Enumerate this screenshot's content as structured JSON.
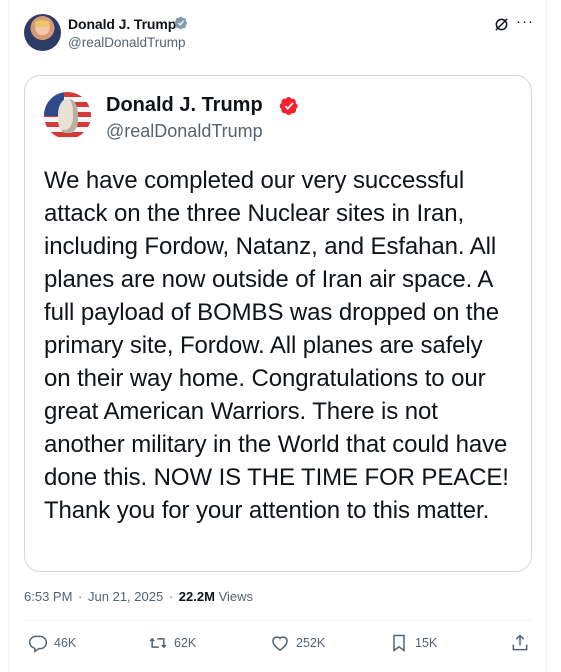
{
  "post": {
    "author_name": "Donald J. Trump",
    "author_handle": "@realDonaldTrump"
  },
  "quoted": {
    "author_name": "Donald J. Trump",
    "author_handle": "@realDonaldTrump",
    "text": "We have completed our very successful attack on the three Nuclear sites in Iran, including Fordow, Natanz, and Esfahan. All planes are now outside of Iran air space. A full payload of BOMBS was dropped on the primary site, Fordow. All planes are safely on their way home. Congratulations to our great American Warriors. There is not another military in the World that could have done this. NOW IS THE TIME FOR PEACE! Thank you for your attention to this matter."
  },
  "meta": {
    "time": "6:53 PM",
    "separator": "·",
    "date": "Jun 21, 2025",
    "views_count": "22.2M",
    "views_label": "Views"
  },
  "actions": {
    "replies": "46K",
    "reposts": "62K",
    "likes": "252K",
    "bookmarks": "15K"
  },
  "icons": {
    "verified_gray": "verified-badge-gray",
    "verified_red": "verified-badge-red",
    "grok": "grok-icon",
    "more": "more-icon",
    "reply": "reply-icon",
    "repost": "repost-icon",
    "like": "heart-icon",
    "bookmark": "bookmark-icon",
    "share": "share-icon"
  },
  "colors": {
    "text": "#0f1419",
    "secondary": "#536471",
    "border": "#cfd9de",
    "verified_gray": "#829aab",
    "verified_red": "#f4212e"
  }
}
